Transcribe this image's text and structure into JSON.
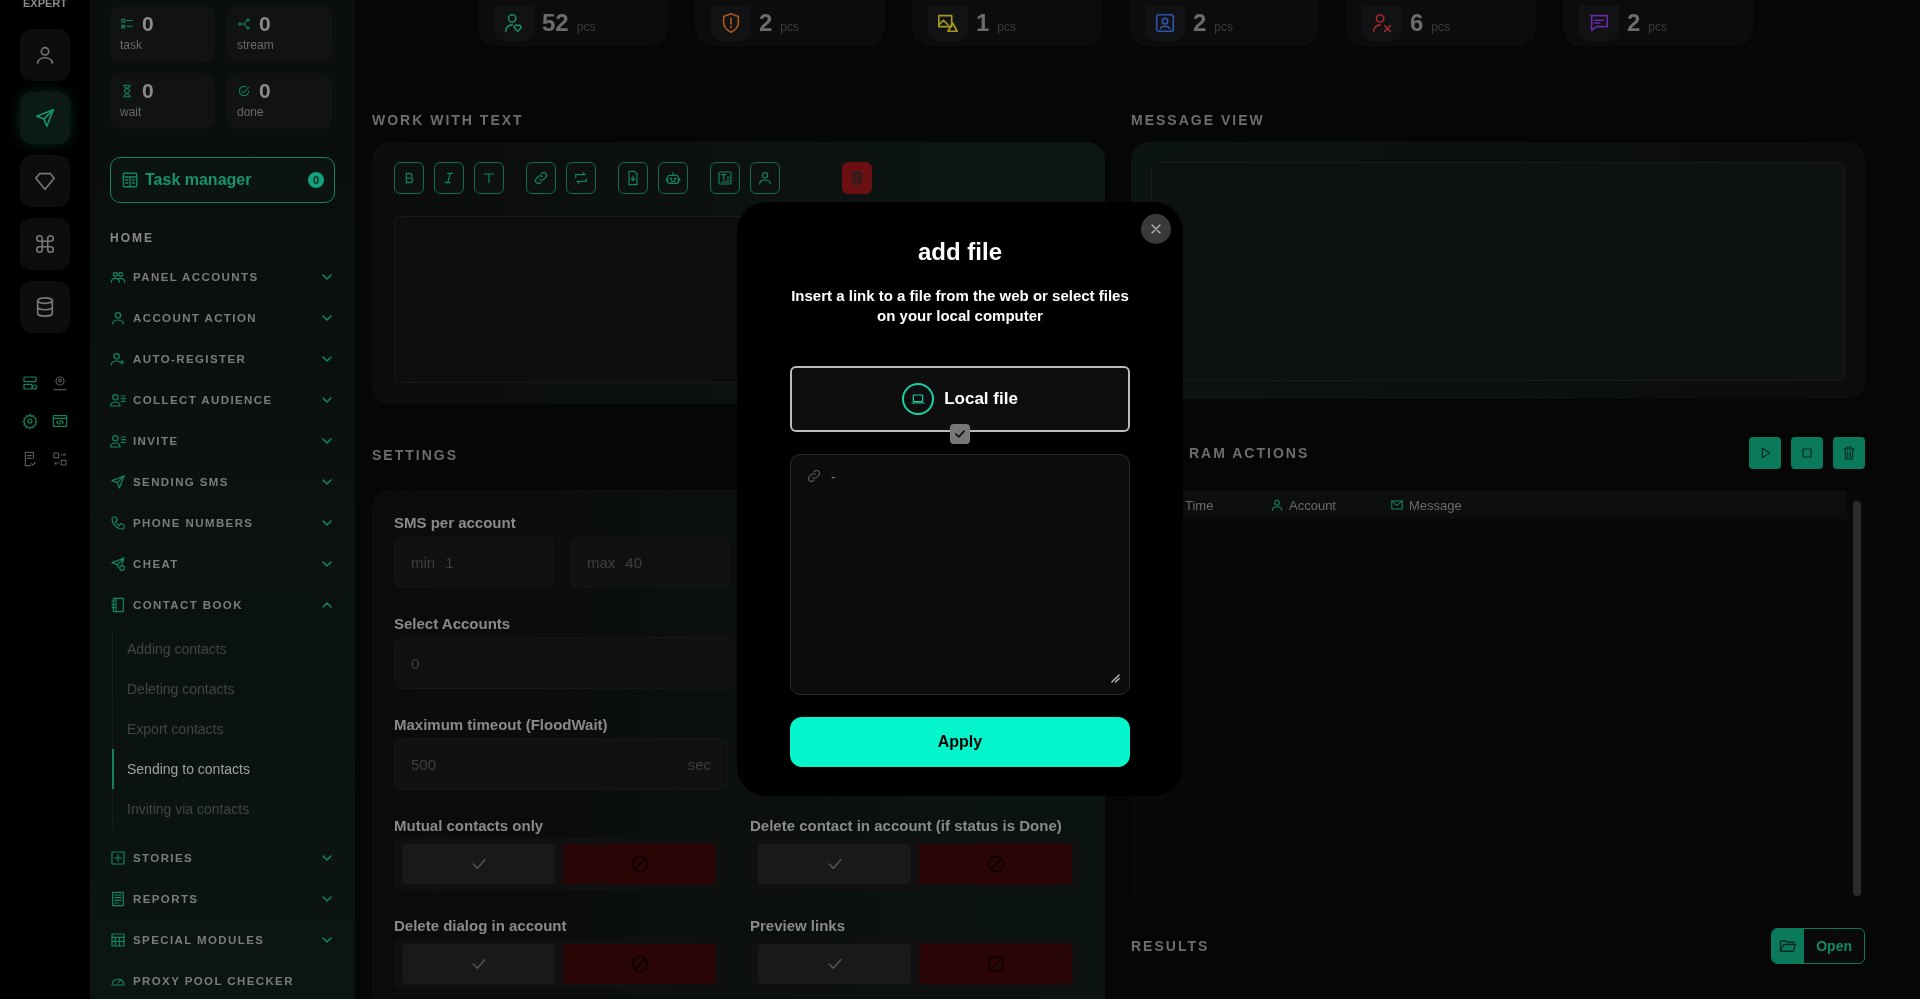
{
  "logo": "EXPERT",
  "rail": [
    {
      "selected": false
    },
    {
      "selected": true
    },
    {
      "selected": false
    },
    {
      "selected": false
    },
    {
      "selected": false
    }
  ],
  "counters": [
    {
      "value": "0",
      "label": "task"
    },
    {
      "value": "0",
      "label": "stream"
    },
    {
      "value": "0",
      "label": "wait"
    },
    {
      "value": "0",
      "label": "done"
    }
  ],
  "task_manager": {
    "label": "Task manager",
    "count": "0"
  },
  "menu": {
    "home": "HOME",
    "items": [
      {
        "label": "PANEL ACCOUNTS",
        "expanded": false
      },
      {
        "label": "ACCOUNT ACTION",
        "expanded": false
      },
      {
        "label": "AUTO-REGISTER",
        "expanded": false
      },
      {
        "label": "COLLECT AUDIENCE",
        "expanded": false
      },
      {
        "label": "INVITE",
        "expanded": false
      },
      {
        "label": "SENDING SMS",
        "expanded": false
      },
      {
        "label": "PHONE NUMBERS",
        "expanded": false
      },
      {
        "label": "CHEAT",
        "expanded": false
      },
      {
        "label": "CONTACT BOOK",
        "expanded": true,
        "children": [
          {
            "label": "Adding contacts",
            "selected": false
          },
          {
            "label": "Deleting contacts",
            "selected": false
          },
          {
            "label": "Export contacts",
            "selected": false
          },
          {
            "label": "Sending to contacts",
            "selected": true
          },
          {
            "label": "Inviting via contacts",
            "selected": false
          }
        ]
      },
      {
        "label": "STORIES",
        "expanded": false
      },
      {
        "label": "REPORTS",
        "expanded": false
      },
      {
        "label": "SPECIAL MODULES",
        "expanded": false
      },
      {
        "label": "PROXY POOL CHECKER"
      }
    ]
  },
  "stats": [
    {
      "value": "52",
      "unit": "pcs",
      "color": "#1b8a63"
    },
    {
      "value": "2",
      "unit": "pcs",
      "color": "#a8571a"
    },
    {
      "value": "1",
      "unit": "pcs",
      "color": "#a89a1f"
    },
    {
      "value": "2",
      "unit": "pcs",
      "color": "#2d52a8"
    },
    {
      "value": "6",
      "unit": "pcs",
      "color": "#a82a2a"
    },
    {
      "value": "2",
      "unit": "pcs",
      "color": "#6a2aa8"
    }
  ],
  "work_with_text": {
    "title": "WORK WITH TEXT"
  },
  "message_view": {
    "title": "MESSAGE VIEW"
  },
  "settings": {
    "title": "SETTINGS",
    "sms_per_account": {
      "label": "SMS per account",
      "min": {
        "prefix": "min",
        "placeholder": "1"
      },
      "max": {
        "prefix": "max",
        "placeholder": "40"
      }
    },
    "select_accounts": {
      "label": "Select Accounts",
      "placeholder": "0"
    },
    "timeout": {
      "label": "Maximum timeout (FloodWait)",
      "placeholder": "500",
      "unit": "sec"
    },
    "toggles": [
      {
        "label": "Mutual contacts only",
        "on": false
      },
      {
        "label": "Delete contact in account (if status is Done)",
        "on": false
      },
      {
        "label": "Delete dialog in account",
        "on": false
      },
      {
        "label": "Preview links",
        "on": false
      }
    ]
  },
  "program_actions": {
    "title": "RAM ACTIONS",
    "columns": [
      "Time",
      "Account",
      "Message"
    ]
  },
  "results": {
    "title": "RESULTS",
    "button": "Open"
  },
  "modal": {
    "title": "add file",
    "description": "Insert a link to a file from the web or select files on your local computer",
    "local_file": {
      "label": "Local file",
      "checked": true
    },
    "link_placeholder": "-",
    "apply": "Apply"
  }
}
